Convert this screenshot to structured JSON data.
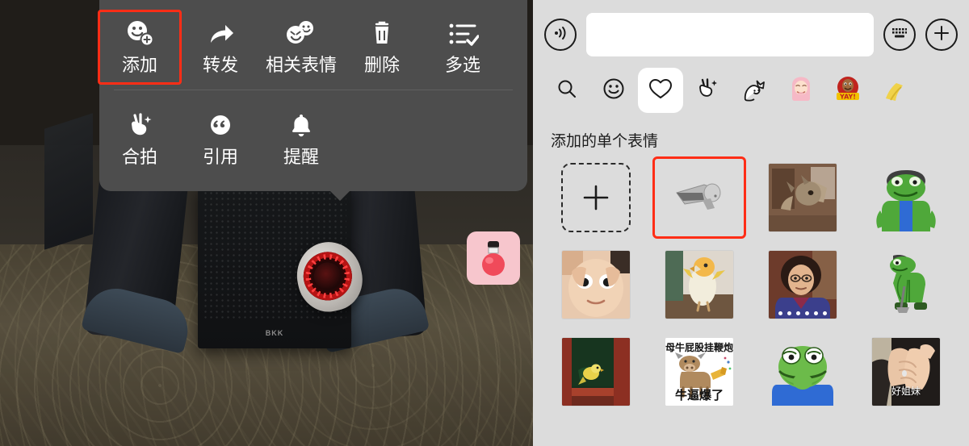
{
  "context_menu": {
    "row1": [
      {
        "label": "添加",
        "icon": "smiley-plus-icon",
        "highlighted": true
      },
      {
        "label": "转发",
        "icon": "forward-arrow-icon",
        "highlighted": false
      },
      {
        "label": "相关表情",
        "icon": "double-smiley-icon",
        "highlighted": false
      },
      {
        "label": "删除",
        "icon": "trash-icon",
        "highlighted": false
      },
      {
        "label": "多选",
        "icon": "multi-select-icon",
        "highlighted": false
      }
    ],
    "row2": [
      {
        "label": "合拍",
        "icon": "peace-hand-sparkle-icon",
        "highlighted": false
      },
      {
        "label": "引用",
        "icon": "quote-icon",
        "highlighted": false
      },
      {
        "label": "提醒",
        "icon": "bell-icon",
        "highlighted": false
      }
    ],
    "background_color": "#4d4d4d",
    "highlight_color": "#ff2d16"
  },
  "photo": {
    "sticker_overlay": {
      "name": "perfume-bottle-sticker",
      "background_color": "#f7c6cd"
    },
    "speaker_logo": "BKK"
  },
  "sticker_panel": {
    "background_color": "#dcdcdc",
    "input": {
      "value": "",
      "placeholder": ""
    },
    "voice_button": "voice-wave-icon",
    "keyboard_button": "keyboard-icon",
    "add_button": "plus-icon",
    "tabs": [
      {
        "name": "search-tab",
        "icon": "search-icon",
        "active": false
      },
      {
        "name": "emoji-tab",
        "icon": "smiley-icon",
        "active": false
      },
      {
        "name": "favorites-tab",
        "icon": "heart-icon",
        "active": true
      },
      {
        "name": "peace-hand-pack-tab",
        "icon": "peace-hand-sparkle-icon",
        "active": false
      },
      {
        "name": "white-cat-pack-tab",
        "icon": "white-cat-icon",
        "active": false
      },
      {
        "name": "pink-hair-pack-tab",
        "icon": "pink-hair-girl-icon",
        "active": false
      },
      {
        "name": "yay-pack-tab",
        "icon": "yay-badge-icon",
        "active": false
      },
      {
        "name": "partial-pack-tab",
        "icon": "partial-sticker-icon",
        "active": false
      }
    ],
    "section_title": "添加的单个表情",
    "stickers": [
      {
        "name": "add-sticker-button",
        "kind": "add",
        "selected": false,
        "caption": ""
      },
      {
        "name": "security-camera-sticker",
        "kind": "camera",
        "selected": true,
        "caption": ""
      },
      {
        "name": "horse-head-sticker",
        "kind": "horse",
        "selected": false,
        "caption": ""
      },
      {
        "name": "green-frog-muscle-sticker",
        "kind": "frog-muscle",
        "selected": false,
        "caption": ""
      },
      {
        "name": "child-eyes-sticker",
        "kind": "child-eyes",
        "selected": false,
        "caption": ""
      },
      {
        "name": "parrot-sticker",
        "kind": "parrot",
        "selected": false,
        "caption": ""
      },
      {
        "name": "woman-portrait-sticker",
        "kind": "woman",
        "selected": false,
        "caption": "",
        "dots": 6
      },
      {
        "name": "green-frog-digging-sticker",
        "kind": "frog-dig",
        "selected": false,
        "caption": ""
      },
      {
        "name": "yellow-bird-window-sticker",
        "kind": "bird-window",
        "selected": false,
        "caption": ""
      },
      {
        "name": "cow-firecracker-sticker",
        "kind": "cow",
        "selected": false,
        "caption_top": "母牛屁股挂鞭炮",
        "caption_bottom": "牛逼爆了"
      },
      {
        "name": "pepe-frog-sticker",
        "kind": "pepe",
        "selected": false,
        "caption": ""
      },
      {
        "name": "clasped-hands-sticker",
        "kind": "hands",
        "selected": false,
        "caption": "好姐妹"
      }
    ]
  }
}
